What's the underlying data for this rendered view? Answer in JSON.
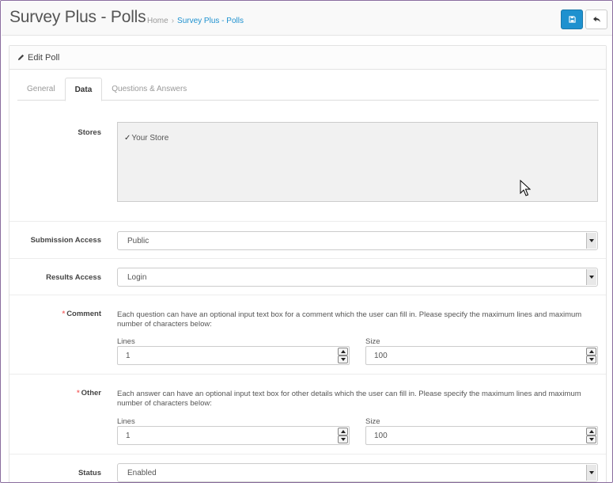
{
  "header": {
    "title": "Survey Plus - Polls",
    "breadcrumb": {
      "home": "Home",
      "separator": "›",
      "current": "Survey Plus - Polls"
    },
    "save_icon": "save-icon",
    "back_icon": "reply-icon"
  },
  "panel": {
    "heading": "Edit Poll",
    "heading_icon": "pencil-icon"
  },
  "tabs": [
    {
      "label": "General"
    },
    {
      "label": "Data",
      "active": true
    },
    {
      "label": "Questions & Answers"
    }
  ],
  "form": {
    "stores": {
      "label": "Stores",
      "options": [
        {
          "label": "Your Store",
          "checked": true
        }
      ]
    },
    "submission_access": {
      "label": "Submission Access",
      "value": "Public"
    },
    "results_access": {
      "label": "Results Access",
      "value": "Login"
    },
    "comment": {
      "required_mark": "*",
      "label": "Comment",
      "help": "Each question can have an optional input text box for a comment which the user can fill in. Please specify the maximum lines and maximum number of characters below:",
      "lines_label": "Lines",
      "lines_value": "1",
      "size_label": "Size",
      "size_value": "100"
    },
    "other": {
      "required_mark": "*",
      "label": "Other",
      "help": "Each answer can have an optional input text box for other details which the user can fill in. Please specify the maximum lines and maximum number of characters below:",
      "lines_label": "Lines",
      "lines_value": "1",
      "size_label": "Size",
      "size_value": "100"
    },
    "status": {
      "label": "Status",
      "value": "Enabled"
    }
  },
  "colors": {
    "primary": "#1e91cf",
    "required": "#f56b6b",
    "frame_border": "#8a6d9e"
  }
}
